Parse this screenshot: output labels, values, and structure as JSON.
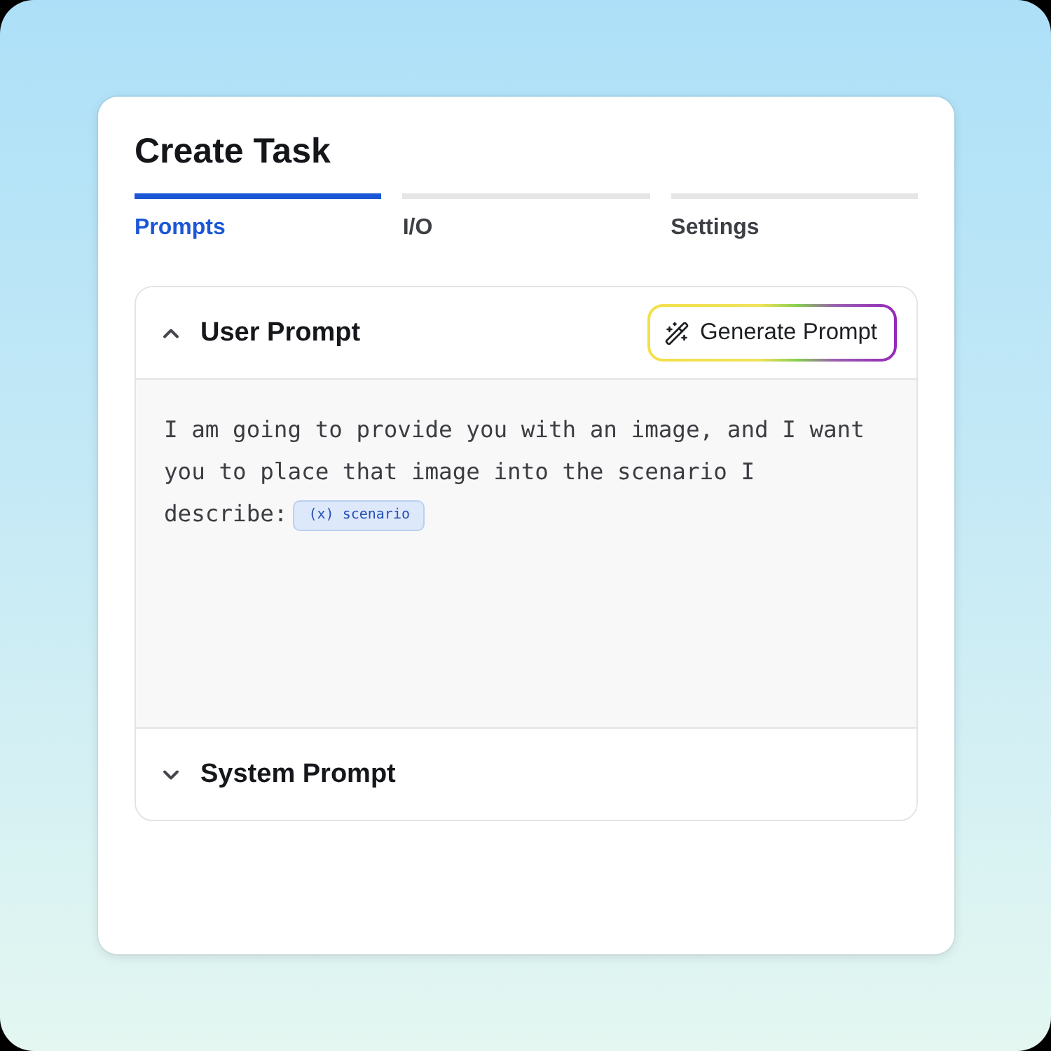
{
  "window": {
    "title": "Create Task"
  },
  "tabs": [
    {
      "label": "Prompts",
      "selected": true
    },
    {
      "label": "I/O",
      "selected": false
    },
    {
      "label": "Settings",
      "selected": false
    }
  ],
  "sections": [
    {
      "title": "User Prompt",
      "expanded": true,
      "action": {
        "label": "Generate Prompt"
      },
      "body": [
        {
          "kind": "text",
          "text": "I am going to provide you with an image, and I want you to place that image into the scenario I describe:"
        },
        {
          "kind": "variable",
          "text": "(x) scenario"
        }
      ]
    },
    {
      "title": "System Prompt",
      "expanded": false
    }
  ]
}
